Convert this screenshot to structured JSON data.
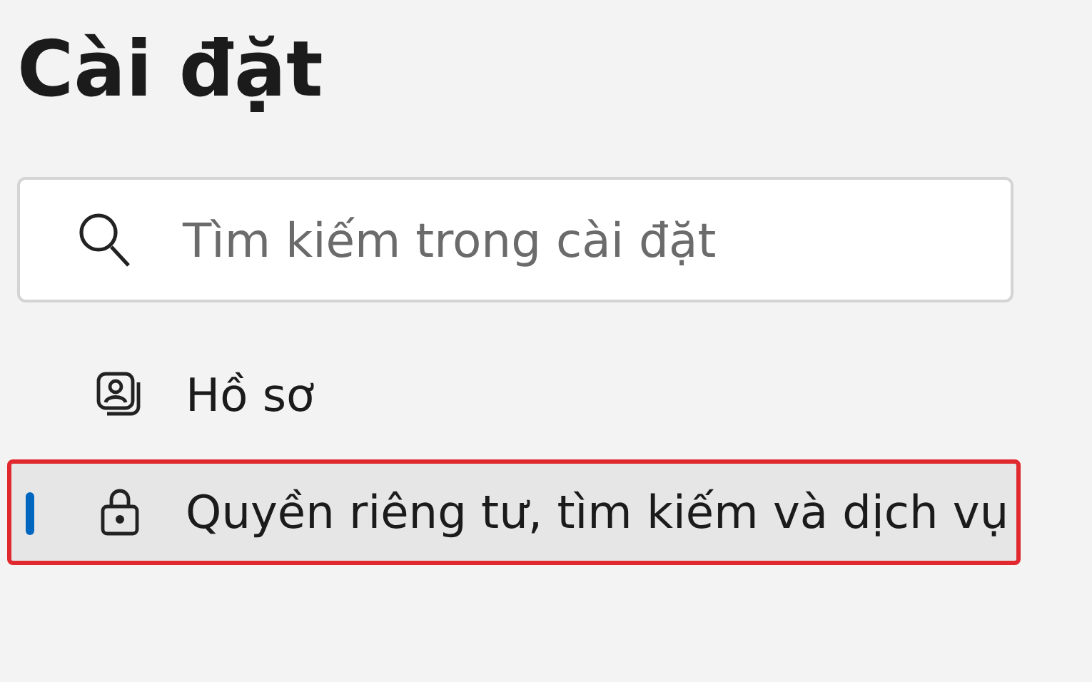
{
  "title": "Cài đặt",
  "search": {
    "placeholder": "Tìm kiếm trong cài đặt"
  },
  "nav_items": [
    {
      "kind": "profile",
      "label": "Hồ sơ",
      "selected": false,
      "highlighted": false
    },
    {
      "kind": "lock",
      "label": "Quyền riêng tư, tìm kiếm và dịch vụ",
      "selected": true,
      "highlighted": true
    }
  ]
}
